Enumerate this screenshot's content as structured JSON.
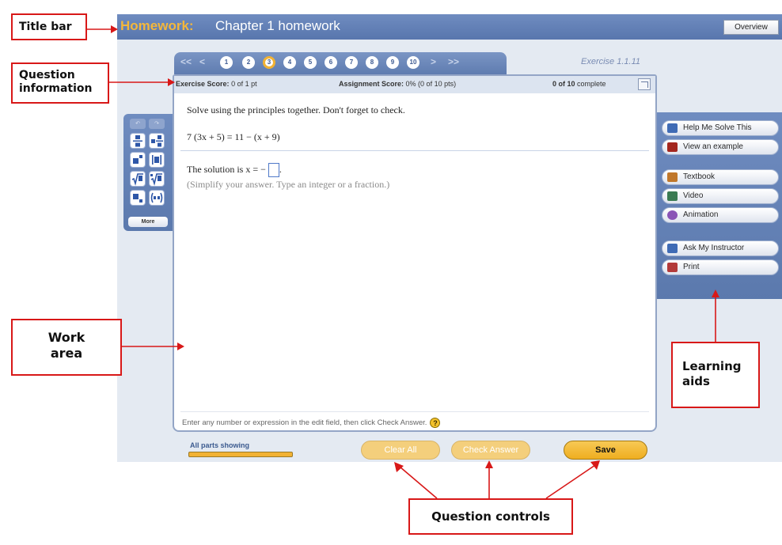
{
  "titlebar": {
    "prefix": "Homework:",
    "title": "Chapter 1 homework",
    "overview_label": "Overview"
  },
  "question_nav": {
    "first_label": "<<",
    "prev_label": "<",
    "next_label": ">",
    "last_label": ">>",
    "numbers": [
      "1",
      "2",
      "3",
      "4",
      "5",
      "6",
      "7",
      "8",
      "9",
      "10"
    ],
    "current": "3",
    "exercise_label": "Exercise 1.1.11"
  },
  "info": {
    "exercise_score_label": "Exercise Score:",
    "exercise_score_value": "0 of 1 pt",
    "assignment_score_label": "Assignment Score:",
    "assignment_score_value": "0% (0 of 10 pts)",
    "complete_count": "0 of 10",
    "complete_label": "complete"
  },
  "question": {
    "instruction": "Solve using the principles together. Don't forget to check.",
    "equation": "7 (3x + 5) = 11 − (x + 9)",
    "solution_prefix": "The solution is x = −",
    "solution_suffix": ".",
    "hint": "(Simplify your answer. Type an integer or a fraction.)",
    "footer_note": "Enter any number or expression in the edit field, then click Check Answer.",
    "help_glyph": "?"
  },
  "palette": {
    "undo_label": "↶",
    "redo_label": "↷",
    "more_label": "More"
  },
  "learning_aids": [
    {
      "label": "Help Me Solve This",
      "icon": "key-icon",
      "color": "#3f6bb5"
    },
    {
      "label": "View an example",
      "icon": "example-icon",
      "color": "#a3261e"
    },
    {
      "label": "Textbook",
      "icon": "book-icon",
      "color": "#c0772a"
    },
    {
      "label": "Video",
      "icon": "video-icon",
      "color": "#3a7a52"
    },
    {
      "label": "Animation",
      "icon": "animation-icon",
      "color": "#8a54b6"
    },
    {
      "label": "Ask My Instructor",
      "icon": "person-icon",
      "color": "#3f6bb5"
    },
    {
      "label": "Print",
      "icon": "printer-icon",
      "color": "#b33a3a"
    }
  ],
  "controls": {
    "all_parts_label": "All parts showing",
    "all_parts_progress": 1.0,
    "clear_all_label": "Clear All",
    "check_answer_label": "Check Answer",
    "save_label": "Save"
  },
  "callouts": {
    "title_bar": "Title bar",
    "question_line1": "Question",
    "question_line2": "information",
    "work_line1": "Work",
    "work_line2": "area",
    "aids_line1": "Learning",
    "aids_line2": "aids",
    "controls": "Question controls"
  },
  "colors": {
    "title_accent": "#f4b73b",
    "titlebar_blue": "#5876ad",
    "save_gold": "#efae20",
    "callout_red": "#d81818"
  }
}
